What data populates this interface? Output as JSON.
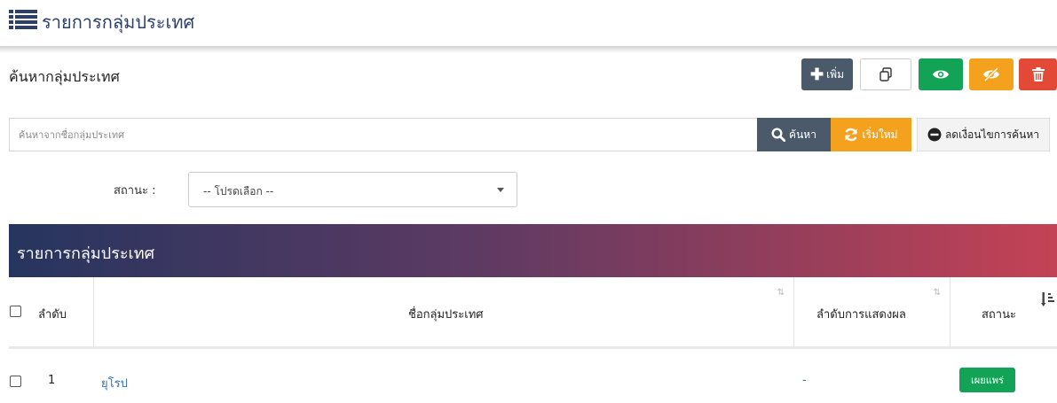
{
  "header": {
    "title": "รายการกลุ่มประเทศ",
    "icon": "list-icon",
    "accent": "#2c3e6b"
  },
  "toolbar": {
    "search_title": "ค้นหากลุ่มประเทศ",
    "add_label": "เพิ่ม",
    "buttons": {
      "add": {
        "icon": "plus-icon",
        "color": "#4b5a6a"
      },
      "copy": {
        "icon": "copy-icon",
        "color": "#ffffff"
      },
      "show": {
        "icon": "eye-icon",
        "color": "#13a356"
      },
      "hide": {
        "icon": "eye-slash-icon",
        "color": "#f4a21d"
      },
      "delete": {
        "icon": "trash-icon",
        "color": "#e24936"
      }
    }
  },
  "search": {
    "placeholder": "ค้นหาจากชื่อกลุ่มประเทศ",
    "search_label": "ค้นหา",
    "reset_label": "เริ่มใหม่",
    "less_label": "ลดเงื่อนไขการค้นหา"
  },
  "filter": {
    "status_label": "สถานะ :",
    "status_value": "-- โปรดเลือก --"
  },
  "table": {
    "panel_title": "รายการกลุ่มประเทศ",
    "gradient": [
      "#26355f",
      "#5e3a63",
      "#c44255"
    ],
    "columns": {
      "order": "ลำดับ",
      "name": "ชื่อกลุ่มประเทศ",
      "sort": "ลำดับการแสดงผล",
      "status": "สถานะ"
    },
    "rows": [
      {
        "num": "1",
        "name": "ยุโรป",
        "sort": "-",
        "status": "เผยแพร่"
      }
    ]
  }
}
